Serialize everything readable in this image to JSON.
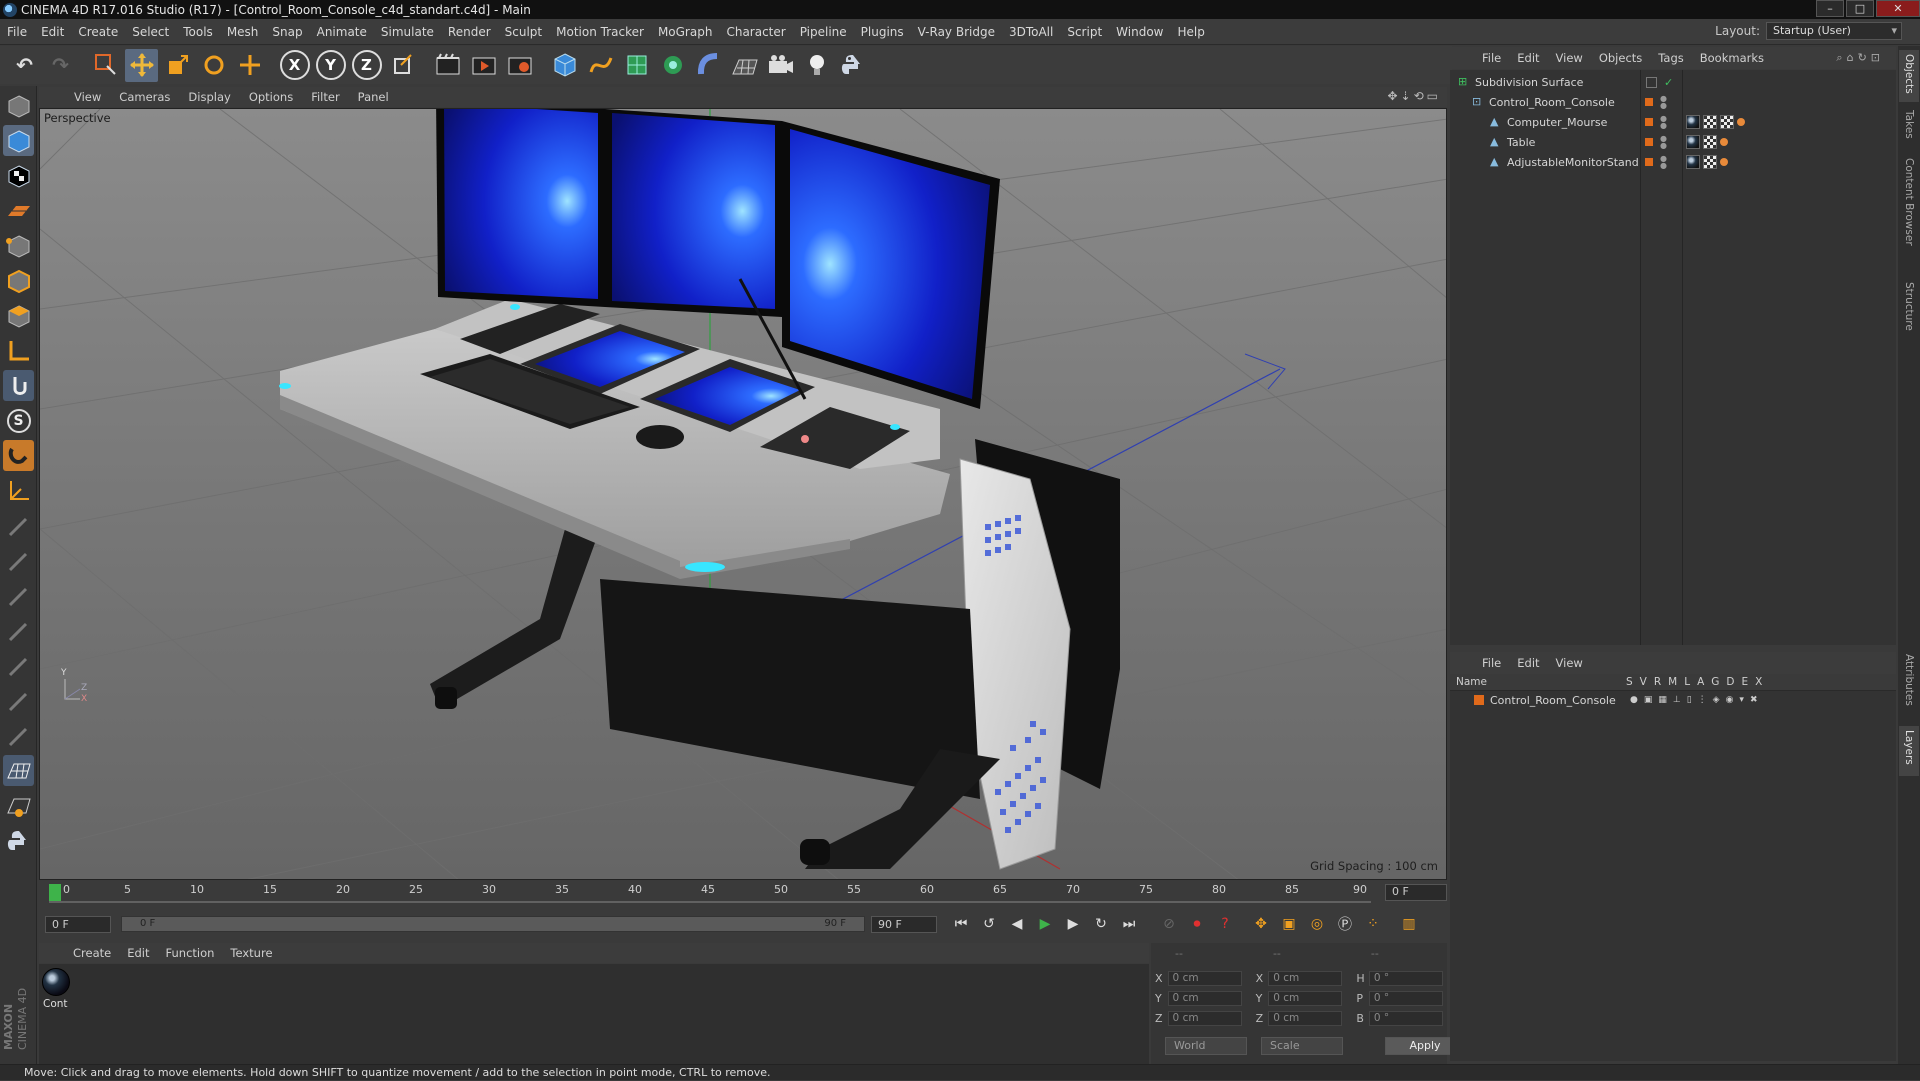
{
  "window": {
    "title": "CINEMA 4D R17.016 Studio (R17) - [Control_Room_Console_c4d_standart.c4d] - Main"
  },
  "menu": [
    "File",
    "Edit",
    "Create",
    "Select",
    "Tools",
    "Mesh",
    "Snap",
    "Animate",
    "Simulate",
    "Render",
    "Sculpt",
    "Motion Tracker",
    "MoGraph",
    "Character",
    "Pipeline",
    "Plugins",
    "V-Ray Bridge",
    "3DToAll",
    "Script",
    "Window",
    "Help"
  ],
  "layout": {
    "label": "Layout:",
    "value": "Startup (User)"
  },
  "toolbar": {
    "axis_x": "X",
    "axis_y": "Y",
    "axis_z": "Z"
  },
  "leftbar": {
    "s_label": "S"
  },
  "branding": {
    "maxon": "MAXON",
    "cinema": "CINEMA 4D"
  },
  "viewport": {
    "menu": [
      "View",
      "Cameras",
      "Display",
      "Options",
      "Filter",
      "Panel"
    ],
    "label": "Perspective",
    "grid_spacing": "Grid Spacing : 100 cm",
    "axis_y": "Y",
    "axis_x": "X",
    "axis_z": "Z"
  },
  "timeline": {
    "ticks": [
      "0",
      "5",
      "10",
      "15",
      "20",
      "25",
      "30",
      "35",
      "40",
      "45",
      "50",
      "55",
      "60",
      "65",
      "70",
      "75",
      "80",
      "85",
      "90"
    ],
    "current_frame_field": "0 F",
    "start_field": "0 F",
    "slider_left": "0 F",
    "slider_right": "90 F",
    "end_field": "90 F"
  },
  "materials": {
    "menu": [
      "Create",
      "Edit",
      "Function",
      "Texture"
    ],
    "items": [
      {
        "name": "Cont"
      }
    ]
  },
  "coordinates": {
    "headers": [
      "--",
      "--",
      "--"
    ],
    "rows": [
      {
        "l1": "X",
        "v1": "0 cm",
        "l2": "X",
        "v2": "0 cm",
        "l3": "H",
        "v3": "0 °"
      },
      {
        "l1": "Y",
        "v1": "0 cm",
        "l2": "Y",
        "v2": "0 cm",
        "l3": "P",
        "v3": "0 °"
      },
      {
        "l1": "Z",
        "v1": "0 cm",
        "l2": "Z",
        "v2": "0 cm",
        "l3": "B",
        "v3": "0 °"
      }
    ],
    "space": "World",
    "mode": "Scale",
    "apply": "Apply"
  },
  "objects": {
    "menu": [
      "File",
      "Edit",
      "View",
      "Objects",
      "Tags",
      "Bookmarks"
    ],
    "tree": [
      {
        "name": "Subdivision Surface",
        "indent": 0
      },
      {
        "name": "Control_Room_Console",
        "indent": 1
      },
      {
        "name": "Computer_Mourse",
        "indent": 2
      },
      {
        "name": "Table",
        "indent": 2
      },
      {
        "name": "AdjustableMonitorStand",
        "indent": 2
      }
    ]
  },
  "layers": {
    "menu": [
      "File",
      "Edit",
      "View"
    ],
    "name_header": "Name",
    "columns": [
      "S",
      "V",
      "R",
      "M",
      "L",
      "A",
      "G",
      "D",
      "E",
      "X"
    ],
    "items": [
      {
        "name": "Control_Room_Console"
      }
    ]
  },
  "right_tabs": [
    "Objects",
    "Takes",
    "Content Browser",
    "Structure",
    "Attributes",
    "Layers"
  ],
  "status": "Move: Click and drag to move elements. Hold down SHIFT to quantize movement / add to the selection in point mode, CTRL to remove.",
  "colors": {
    "accent_orange": "#e06a1b",
    "screen_blue": "#1b2dd8",
    "glow_cyan": "#38e6ff"
  }
}
